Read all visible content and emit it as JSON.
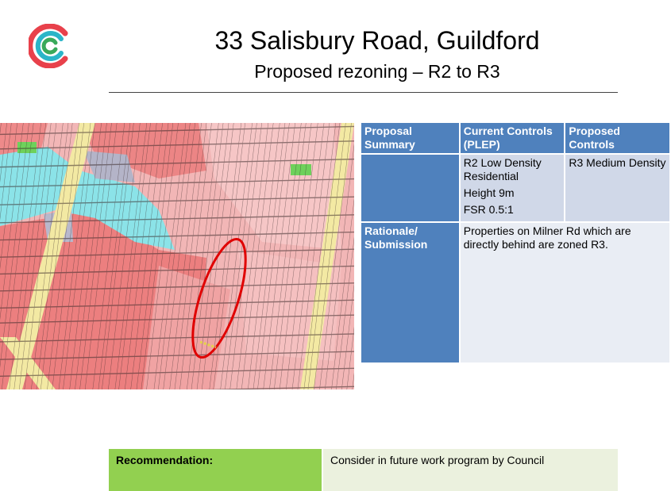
{
  "slide": {
    "title": "33 Salisbury Road, Guildford",
    "subtitle": "Proposed rezoning – R2 to R3"
  },
  "logo": {
    "icon": "council-c-logo-icon",
    "colors": [
      "#e8414b",
      "#2bb5c8",
      "#3aa95a"
    ]
  },
  "table": {
    "headers": {
      "summary": "Proposal Summary",
      "current": "Current Controls (PLEP)",
      "proposed": "Proposed Controls"
    },
    "current_controls": [
      "R2 Low Density Residential",
      "Height 9m",
      "FSR 0.5:1"
    ],
    "proposed_controls": "R3 Medium Density",
    "rationale_label": "Rationale/ Submission",
    "rationale_text": "Properties on Milner Rd which are directly behind are zoned R3."
  },
  "recommendation": {
    "label": "Recommendation:",
    "text": "Consider in future work program by Council"
  },
  "colors": {
    "header_blue": "#4f81bd",
    "cell_light": "#d0d8e8",
    "rec_green": "#92d050",
    "rec_light": "#ebf1de",
    "highlight_red": "#e00000"
  }
}
